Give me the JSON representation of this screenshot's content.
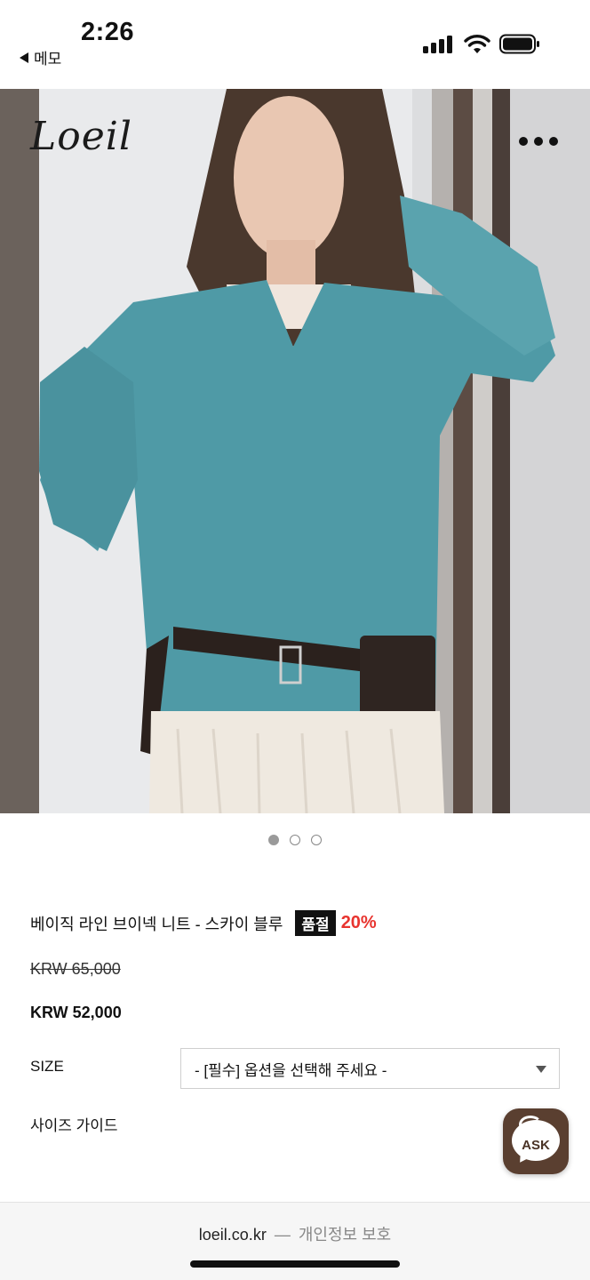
{
  "status_bar": {
    "time": "2:26",
    "back_app_label": "메모"
  },
  "header": {
    "logo_text": "Loeil",
    "more_icon": "ellipsis-icon"
  },
  "carousel": {
    "slide_count": 3,
    "active_index": 0
  },
  "product": {
    "title": "베이직 라인 브이넥 니트 - 스카이 블루",
    "soldout_badge": "품절",
    "discount": "20%",
    "original_price": "KRW 65,000",
    "sale_price": "KRW 52,000",
    "size_label": "SIZE",
    "size_select_value": "- [필수] 옵션을 선택해 주세요 -",
    "size_guide": "사이즈 가이드"
  },
  "ask_button": {
    "label": "ASK"
  },
  "footer": {
    "domain": "loeil.co.kr",
    "separator": "—",
    "link": "개인정보 보호"
  },
  "colors": {
    "accent_discount": "#e8342f",
    "badge_bg": "#111111",
    "ask_bg": "#5a3f30",
    "sweater": "#4f9aa6"
  }
}
